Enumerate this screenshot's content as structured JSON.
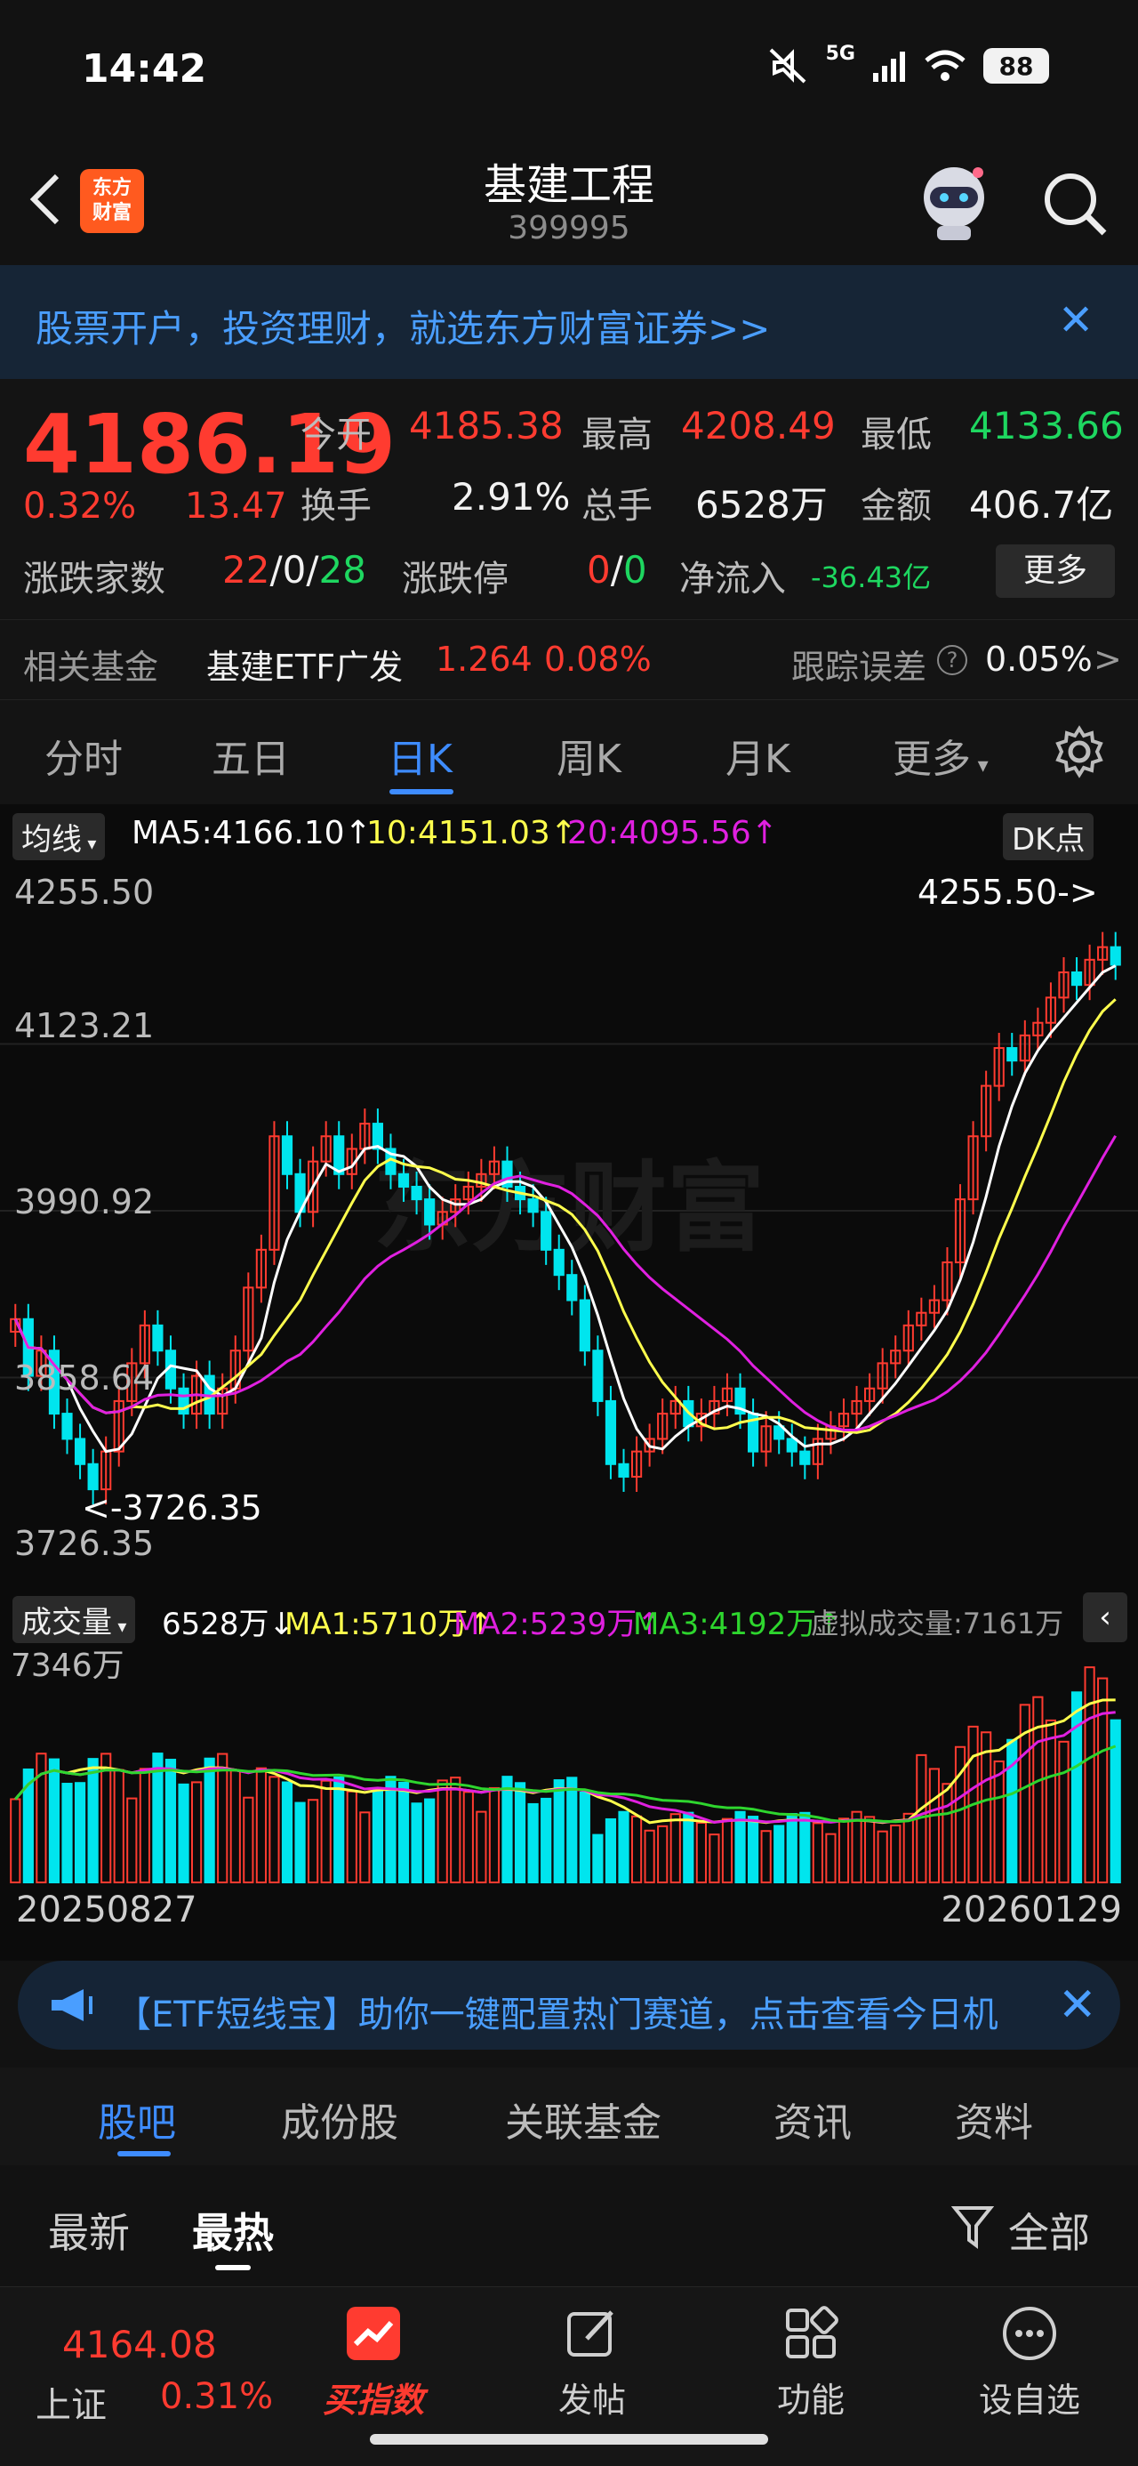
{
  "status": {
    "time": "14:42",
    "battery": "88",
    "network": "5G"
  },
  "nav": {
    "logo_line1": "东方",
    "logo_line2": "财富",
    "title": "基建工程",
    "code": "399995"
  },
  "banner": {
    "text": "股票开户，投资理财，就选东方财富证券>>"
  },
  "quote": {
    "price": "4186.19",
    "change_pct": "0.32%",
    "change_val": "13.47",
    "open_label": "今开",
    "open": "4185.38",
    "high_label": "最高",
    "high": "4208.49",
    "low_label": "最低",
    "low": "4133.66",
    "turnover_label": "换手",
    "turnover": "2.91%",
    "volume_label": "总手",
    "volume": "6528万",
    "amount_label": "金额",
    "amount": "406.7亿",
    "breadth_label": "涨跌家数",
    "breadth_up": "22",
    "breadth_flat": "0",
    "breadth_down": "28",
    "limit_label": "涨跌停",
    "limit_up": "0",
    "limit_down": "0",
    "inflow_label": "净流入",
    "inflow": "-36.43亿",
    "more": "更多"
  },
  "fund": {
    "label": "相关基金",
    "name": "基建ETF广发",
    "price": "1.264",
    "pct": "0.08%",
    "err_label": "跟踪误差",
    "err": "0.05%",
    "arrow": ">"
  },
  "tabs": [
    "分时",
    "五日",
    "日K",
    "周K",
    "月K",
    "更多"
  ],
  "active_tab": 2,
  "ma": {
    "selector": "均线",
    "ma5": "MA5:4166.10↑",
    "ma10": "10:4151.03↑",
    "ma20": "20:4095.56↑",
    "dk": "DK点"
  },
  "kline_axis": {
    "max": "4255.50",
    "l2": "4123.21",
    "l3": "3990.92",
    "l4": "3858.64",
    "min": "3726.35",
    "max_marker": "4255.50->",
    "min_marker": "<-3726.35",
    "watermark": "东方财富"
  },
  "vol": {
    "selector": "成交量",
    "value": "6528万↓",
    "ma1": "MA1:5710万↑",
    "ma2": "MA2:5239万↑",
    "ma3": "MA3:4192万↑",
    "virtual": "虚拟成交量:7161万",
    "max": "7346万"
  },
  "dates": {
    "start": "20250827",
    "end": "20260129"
  },
  "promo": {
    "text": "【ETF短线宝】助你一键配置热门赛道，点击查看今日机"
  },
  "subtabs": [
    "股吧",
    "成份股",
    "关联基金",
    "资讯",
    "资料"
  ],
  "filter": {
    "latest": "最新",
    "hot": "最热",
    "all": "全部"
  },
  "bottom": {
    "index_value": "4164.08",
    "index_name": "上证",
    "index_pct": "0.31%",
    "buy_index": "买指数",
    "post": "发帖",
    "func": "功能",
    "watch": "设自选"
  },
  "colors": {
    "up": "#ff3b30",
    "down": "#00e5ee",
    "ma5": "#ffffff",
    "ma10": "#ffff4d",
    "ma20": "#e020e0",
    "accent": "#3e8cff"
  },
  "chart_data": {
    "type": "candlestick",
    "x_start": "20250827",
    "x_end": "20260129",
    "ylim": [
      3726.35,
      4255.5
    ],
    "close": [
      3905,
      3860,
      3880,
      3830,
      3810,
      3790,
      3770,
      3800,
      3840,
      3870,
      3900,
      3880,
      3850,
      3830,
      3860,
      3830,
      3850,
      3880,
      3930,
      3960,
      4050,
      4020,
      3990,
      4030,
      4050,
      4020,
      4040,
      4060,
      4040,
      4020,
      4010,
      4000,
      3980,
      3990,
      4000,
      4010,
      4020,
      4030,
      4010,
      4000,
      3990,
      3960,
      3940,
      3920,
      3880,
      3840,
      3790,
      3780,
      3800,
      3810,
      3830,
      3840,
      3820,
      3830,
      3840,
      3850,
      3830,
      3800,
      3820,
      3810,
      3800,
      3790,
      3810,
      3820,
      3830,
      3840,
      3850,
      3870,
      3880,
      3900,
      3910,
      3920,
      3950,
      4000,
      4050,
      4090,
      4120,
      4110,
      4130,
      4140,
      4160,
      4180,
      4170,
      4190,
      4200,
      4186
    ],
    "volume_range": [
      0,
      7346
    ]
  }
}
